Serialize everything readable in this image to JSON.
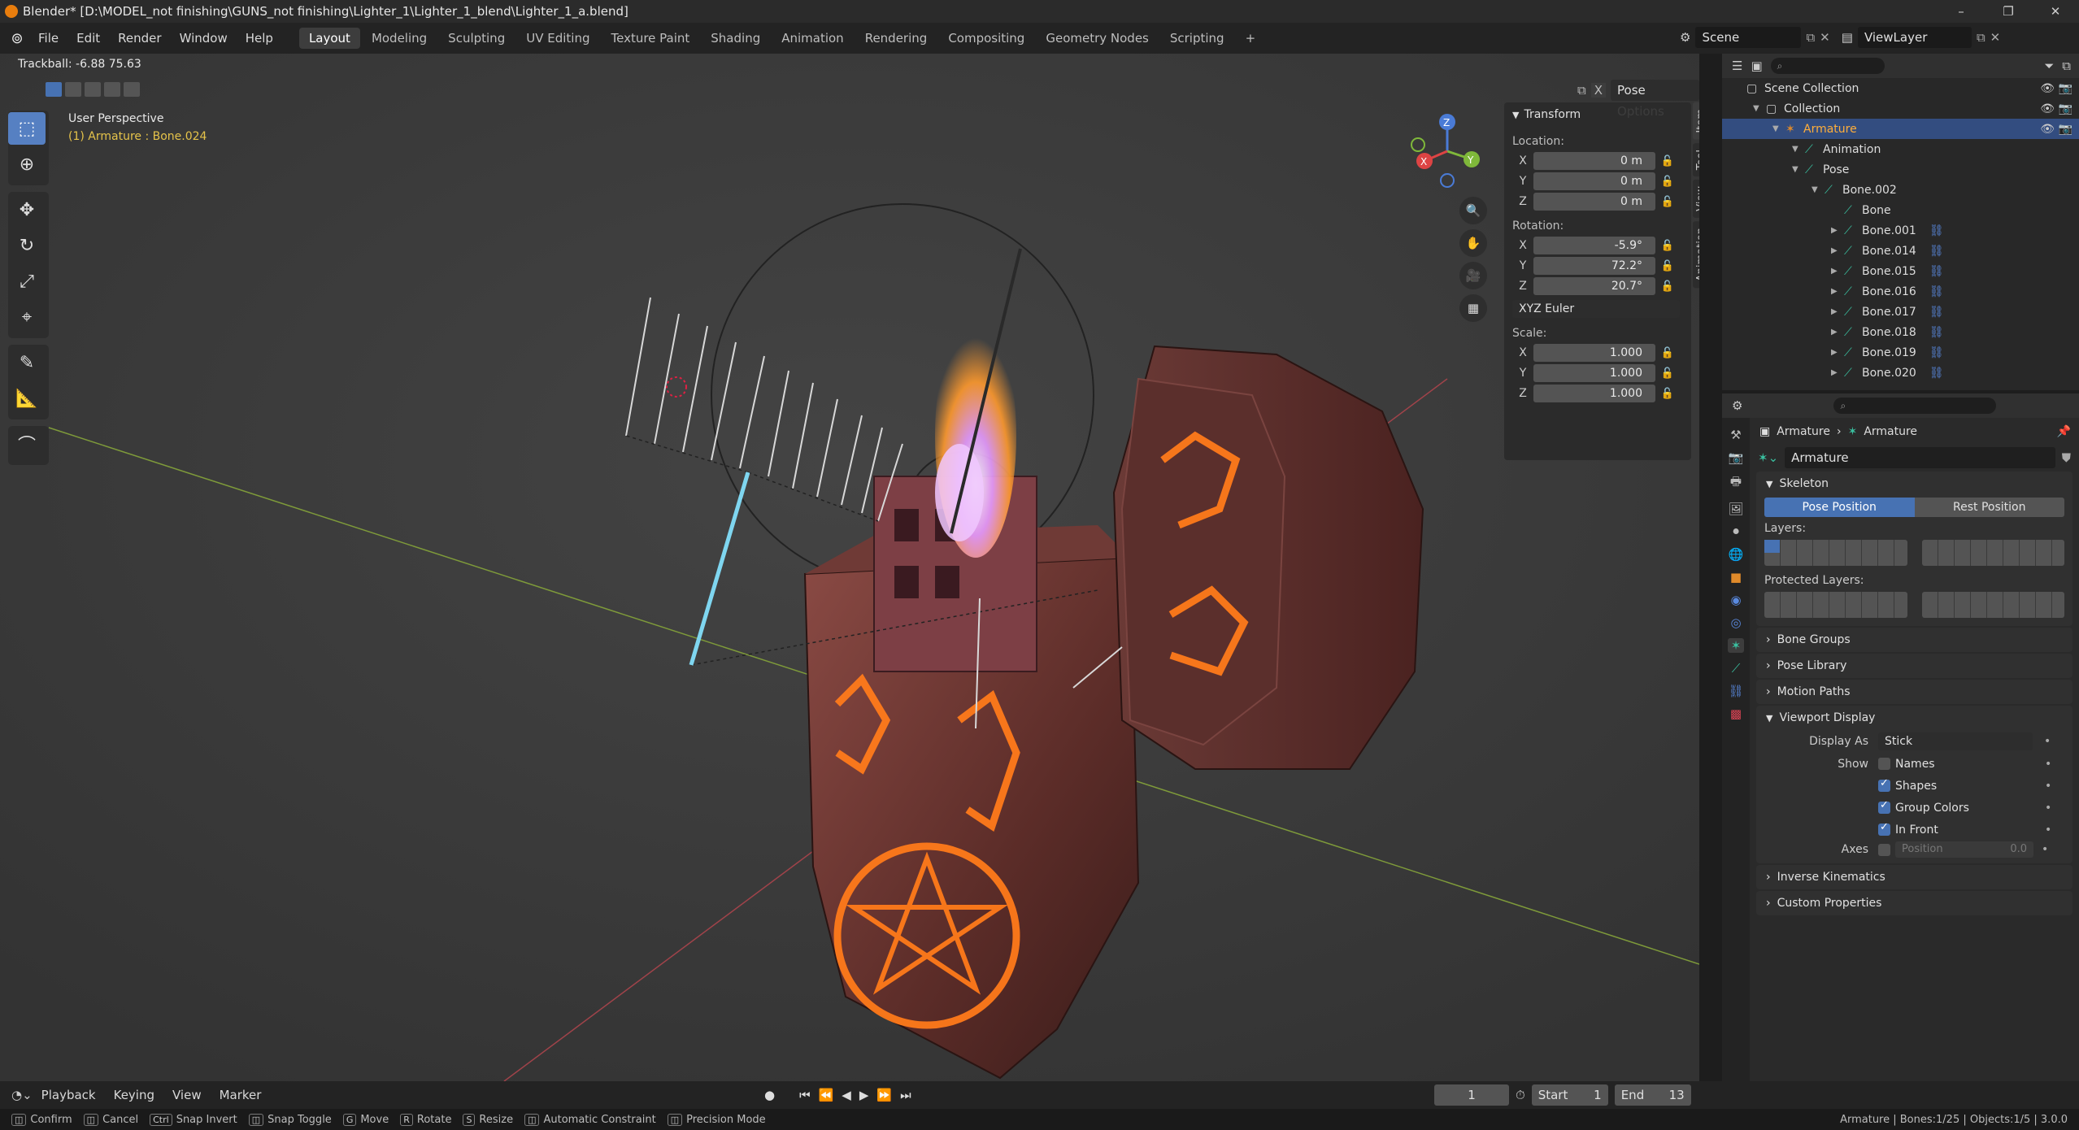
{
  "window": {
    "title": "Blender* [D:\\MODEL_not finishing\\GUNS_not finishing\\Lighter_1\\Lighter_1_blend\\Lighter_1_a.blend]",
    "controls": [
      "–",
      "❐",
      "✕"
    ]
  },
  "menu": {
    "items": [
      "File",
      "Edit",
      "Render",
      "Window",
      "Help"
    ]
  },
  "workspaces": {
    "tabs": [
      "Layout",
      "Modeling",
      "Sculpting",
      "UV Editing",
      "Texture Paint",
      "Shading",
      "Animation",
      "Rendering",
      "Compositing",
      "Geometry Nodes",
      "Scripting"
    ],
    "active": "Layout",
    "add": "+"
  },
  "scene": {
    "label": "Scene",
    "view_layer": "ViewLayer"
  },
  "viewport": {
    "operator_status": "Trackball: -6.88 75.63",
    "perspective": "User Perspective",
    "active_object": "(1) Armature : Bone.024",
    "pose_options": "Pose Options",
    "gizmo_axes": {
      "x": "X",
      "y": "Y",
      "z": "Z"
    }
  },
  "transform_panel": {
    "title": "Transform",
    "location_label": "Location:",
    "location": [
      {
        "axis": "X",
        "value": "0 m"
      },
      {
        "axis": "Y",
        "value": "0 m"
      },
      {
        "axis": "Z",
        "value": "0 m"
      }
    ],
    "rotation_label": "Rotation:",
    "rotation": [
      {
        "axis": "X",
        "value": "-5.9°"
      },
      {
        "axis": "Y",
        "value": "72.2°"
      },
      {
        "axis": "Z",
        "value": "20.7°"
      }
    ],
    "rotation_mode": "XYZ Euler",
    "scale_label": "Scale:",
    "scale": [
      {
        "axis": "X",
        "value": "1.000"
      },
      {
        "axis": "Y",
        "value": "1.000"
      },
      {
        "axis": "Z",
        "value": "1.000"
      }
    ]
  },
  "side_tabs": [
    "Item",
    "Tool",
    "View",
    "Animation"
  ],
  "outliner": {
    "rows": [
      {
        "label": "Scene Collection",
        "indent": 0
      },
      {
        "label": "Collection",
        "indent": 1
      },
      {
        "label": "Armature",
        "indent": 2,
        "selected": true
      },
      {
        "label": "Animation",
        "indent": 3
      },
      {
        "label": "Pose",
        "indent": 3
      },
      {
        "label": "Bone.002",
        "indent": 4
      },
      {
        "label": "Bone",
        "indent": 5
      },
      {
        "label": "Bone.001",
        "indent": 5
      },
      {
        "label": "Bone.014",
        "indent": 5
      },
      {
        "label": "Bone.015",
        "indent": 5
      },
      {
        "label": "Bone.016",
        "indent": 5
      },
      {
        "label": "Bone.017",
        "indent": 5
      },
      {
        "label": "Bone.018",
        "indent": 5
      },
      {
        "label": "Bone.019",
        "indent": 5
      },
      {
        "label": "Bone.020",
        "indent": 5
      }
    ]
  },
  "properties": {
    "breadcrumb": [
      "Armature",
      "Armature"
    ],
    "data_name": "Armature",
    "skeleton": {
      "title": "Skeleton",
      "pose_position": "Pose Position",
      "rest_position": "Rest Position",
      "layers_label": "Layers:",
      "protected_label": "Protected Layers:"
    },
    "collapsed_panels": [
      "Bone Groups",
      "Pose Library",
      "Motion Paths"
    ],
    "viewport_display": {
      "title": "Viewport Display",
      "display_as_label": "Display As",
      "display_as_value": "Stick",
      "show_label": "Show",
      "options": [
        {
          "label": "Names",
          "checked": false
        },
        {
          "label": "Shapes",
          "checked": true
        },
        {
          "label": "Group Colors",
          "checked": true
        },
        {
          "label": "In Front",
          "checked": true
        }
      ],
      "axes_label": "Axes",
      "axes_position_label": "Position",
      "axes_position_value": "0.0"
    },
    "bottom_panels": [
      "Inverse Kinematics",
      "Custom Properties"
    ]
  },
  "timeline": {
    "menus": [
      "Playback",
      "Keying",
      "View",
      "Marker"
    ],
    "current_frame": "1",
    "start_label": "Start",
    "start": "1",
    "end_label": "End",
    "end": "13"
  },
  "statusbar": {
    "hints": [
      {
        "key": "",
        "label": "Confirm"
      },
      {
        "key": "",
        "label": "Cancel"
      },
      {
        "key": "Ctrl",
        "label": "Snap Invert"
      },
      {
        "key": "",
        "label": "Snap Toggle"
      },
      {
        "key": "G",
        "label": "Move"
      },
      {
        "key": "R",
        "label": "Rotate"
      },
      {
        "key": "S",
        "label": "Resize"
      },
      {
        "key": "",
        "label": "Automatic Constraint"
      },
      {
        "key": "",
        "label": "Precision Mode"
      }
    ],
    "info": "Armature | Bones:1/25 | Objects:1/5 | 3.0.0"
  },
  "colors": {
    "accent": "#4772b3",
    "selected_row": "#334d80",
    "viewport_bg": "#3a3a3a",
    "glow": "#ff7a1a",
    "bone_active": "#7fd6f0"
  }
}
